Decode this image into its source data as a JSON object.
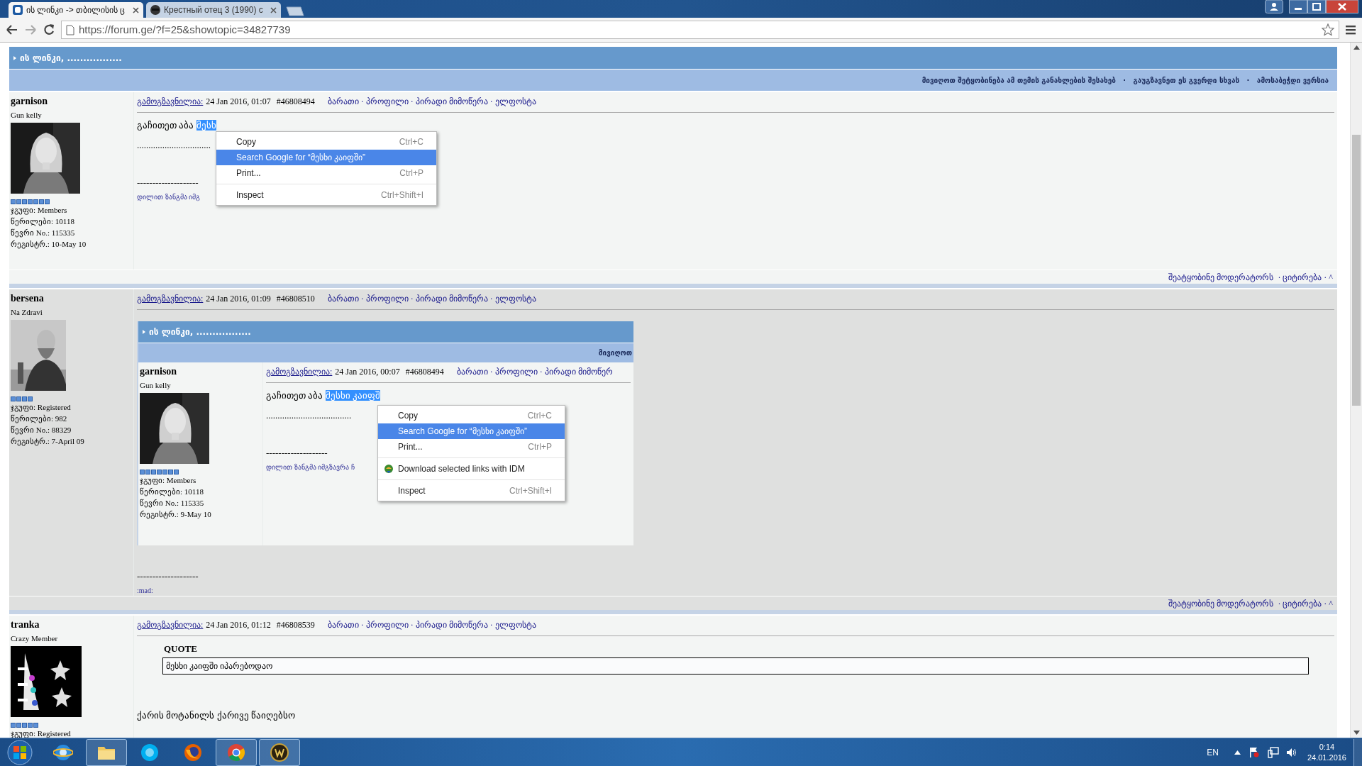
{
  "browser": {
    "tabs": [
      {
        "title": "ის ლინკი -> თბილისის ც",
        "selected": true
      },
      {
        "title": "Крестный отец 3 (1990) с",
        "selected": false
      }
    ],
    "url": "https://forum.ge/?f=25&showtopic=34827739"
  },
  "topic": {
    "title": "ის ლინკი, .................",
    "actions": "მივიღოთ შეტყობინება ამ თემის განახლების შესახებ   ·   გაუგზავნეთ ეს გვერდი სხვას   ·   ამოსაბეჭდი ვერსია"
  },
  "posts": [
    {
      "author": "garnison",
      "member_title": "Gun kelly",
      "stars": 7,
      "stats": [
        "ჯგუფი: Members",
        "წერილები: 10118",
        "წევრი No.: 115335",
        "რეგისტრ.: 10-May 10"
      ],
      "posted_label": "გამოგზავნილია:",
      "date": "24 Jan 2016, 01:07",
      "number": "#46808494",
      "links": "ბარათი · პროფილი · პირადი მიმოწერა · ელფოსტა",
      "body": [
        {
          "kind": "text",
          "text": "გაჩითეთ აბა ",
          "selection": "მესხ"
        },
        {
          "kind": "text",
          "text": "................................"
        },
        {
          "kind": "rule",
          "text": "--------------------"
        },
        {
          "kind": "signature",
          "text": "დილით ზანგმა იმგ"
        }
      ],
      "footer": "შეატყობინე მოდერატორს  · ციტირება · ^"
    },
    {
      "author": "bersena",
      "member_title": "Na Zdravi",
      "stars": 4,
      "stats": [
        "ჯგუფი: Registered",
        "წერილები: 982",
        "წევრი No.: 88329",
        "რეგისტრ.: 7-April 09"
      ],
      "posted_label": "გამოგზავნილია:",
      "date": "24 Jan 2016, 01:09",
      "number": "#46808510",
      "links": "ბარათი · პროფილი · პირადი მიმოწერა · ელფოსტა",
      "body": [
        {
          "kind": "screenshot",
          "topic_title": "ის ლინკი, .................",
          "action": "მივიღოთ",
          "post": {
            "author": "garnison",
            "member_title": "Gun kelly",
            "stars": 7,
            "stats": [
              "ჯგუფი: Members",
              "წერილები: 10118",
              "წევრი No.: 115335",
              "რეგისტრ.: 9-May 10"
            ],
            "posted_label": "გამოგზავნილია:",
            "date": "24 Jan 2016, 00:07",
            "number": "#46808494",
            "links": "ბარათი · პროფილი · პირადი მიმოწერ",
            "body": [
              {
                "kind": "text",
                "text": "გაჩითეთ აბა ",
                "selection": "მესხი კაიფშ"
              },
              {
                "kind": "text",
                "text": "....................................."
              },
              {
                "kind": "rule",
                "text": "--------------------"
              },
              {
                "kind": "signature",
                "text": "დილით ზანგმა იმგზავრა ჩ"
              }
            ]
          },
          "context_menu": [
            {
              "kind": "item",
              "label": "Copy",
              "shortcut": "Ctrl+C",
              "selected": false
            },
            {
              "kind": "item",
              "label": "Search Google for “მესხი კაიფში”",
              "selected": true
            },
            {
              "kind": "item",
              "label": "Print...",
              "shortcut": "Ctrl+P",
              "selected": false
            },
            {
              "kind": "separator"
            },
            {
              "kind": "icon_item",
              "label": "Download selected links with IDM",
              "selected": false
            },
            {
              "kind": "separator"
            },
            {
              "kind": "item",
              "label": "Inspect",
              "shortcut": "Ctrl+Shift+I",
              "selected": false
            }
          ]
        },
        {
          "kind": "rule",
          "text": "--------------------"
        },
        {
          "kind": "signature",
          "text": ":mad:"
        }
      ],
      "footer": "შეატყობინე მოდერატორს  · ციტირება · ^"
    },
    {
      "author": "tranka",
      "member_title": "Crazy Member",
      "stars": 5,
      "stats": [
        "ჯგუფი: Registered"
      ],
      "posted_label": "გამოგზავნილია:",
      "date": "24 Jan 2016, 01:12",
      "number": "#46808539",
      "links": "ბარათი · პროფილი · პირადი მიმოწერა · ელფოსტა",
      "body": [
        {
          "kind": "quote",
          "label": "QUOTE",
          "text": "მესხი კაიფში იპარებოდაო"
        },
        {
          "kind": "text",
          "text": "ქარის მოტანილს ქარივე წაიღებსო"
        }
      ]
    }
  ],
  "context_menu": [
    {
      "kind": "item",
      "label": "Copy",
      "shortcut": "Ctrl+C",
      "selected": false
    },
    {
      "kind": "item",
      "label": "Search Google for “მესხი კაიფში”",
      "selected": true
    },
    {
      "kind": "item",
      "label": "Print...",
      "shortcut": "Ctrl+P",
      "selected": false
    },
    {
      "kind": "separator"
    },
    {
      "kind": "item",
      "label": "Inspect",
      "shortcut": "Ctrl+Shift+I",
      "selected": false
    }
  ],
  "taskbar": {
    "apps": [
      {
        "kind": "ie",
        "running": false
      },
      {
        "kind": "folder",
        "running": true
      },
      {
        "kind": "skype",
        "running": false
      },
      {
        "kind": "firefox",
        "running": false
      },
      {
        "kind": "chrome",
        "running": true
      },
      {
        "kind": "game",
        "running": true
      }
    ],
    "language": "EN",
    "time": "0:14",
    "date": "24.01.2016"
  }
}
